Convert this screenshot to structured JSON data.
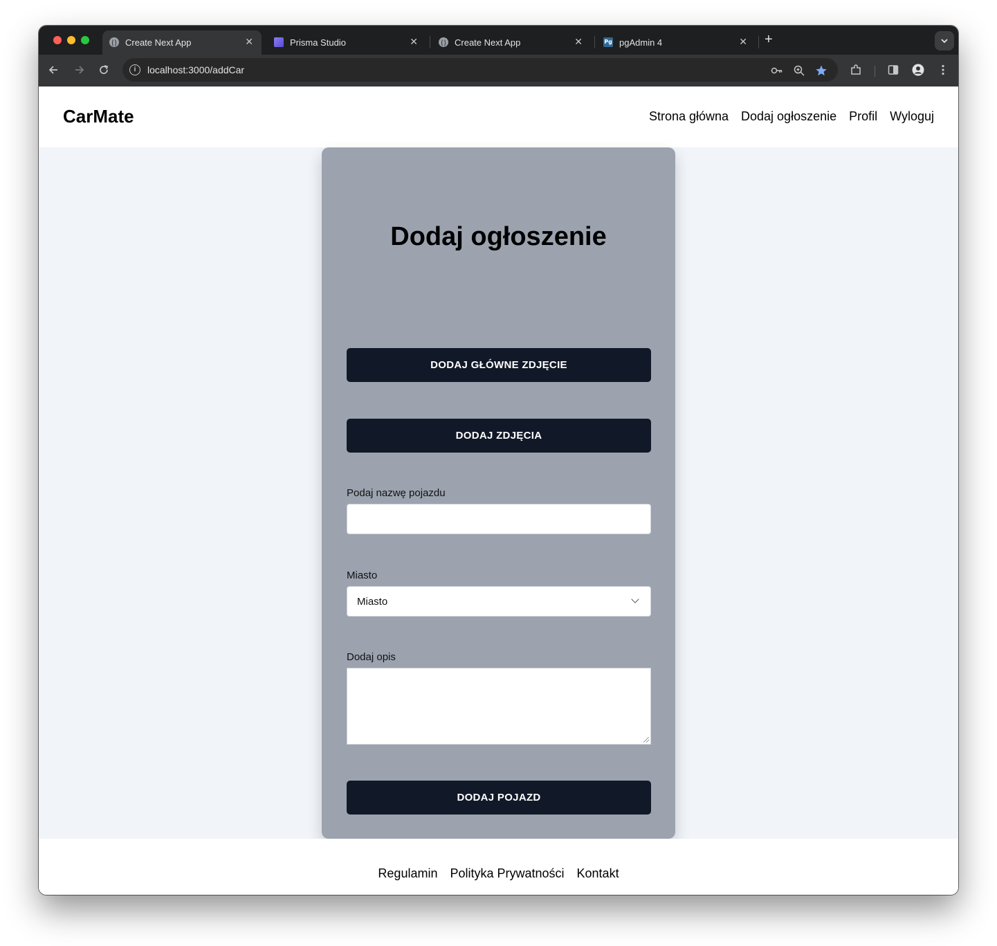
{
  "browser": {
    "tabs": [
      {
        "title": "Create Next App",
        "icon": "globe-icon",
        "active": true
      },
      {
        "title": "Prisma Studio",
        "icon": "prisma-icon",
        "active": false
      },
      {
        "title": "Create Next App",
        "icon": "globe-icon",
        "active": false
      },
      {
        "title": "pgAdmin 4",
        "icon": "pgadmin-icon",
        "active": false
      }
    ],
    "tab_close_glyph": "✕",
    "new_tab_glyph": "+",
    "url": "localhost:3000/addCar",
    "pgadmin_icon_text": "Pg",
    "bookmark_starred": true,
    "accent_color": "#7cacf8"
  },
  "site": {
    "brand": "CarMate",
    "nav": [
      "Strona główna",
      "Dodaj ogłoszenie",
      "Profil",
      "Wyloguj"
    ]
  },
  "form": {
    "title": "Dodaj ogłoszenie",
    "main_photo_button": "DODAJ GŁÓWNE ZDJĘCIE",
    "photos_button": "DODAJ ZDJĘCIA",
    "name_label": "Podaj nazwę pojazdu",
    "name_value": "",
    "city_label": "Miasto",
    "city_selected": "Miasto",
    "description_label": "Dodaj opis",
    "description_value": "",
    "submit_button": "DODAJ POJAZD"
  },
  "footer": {
    "links": [
      "Regulamin",
      "Polityka Prywatności",
      "Kontakt"
    ]
  },
  "colors": {
    "card_background": "#9ca3af",
    "page_background": "#f1f4f9",
    "button_background": "#111827"
  }
}
